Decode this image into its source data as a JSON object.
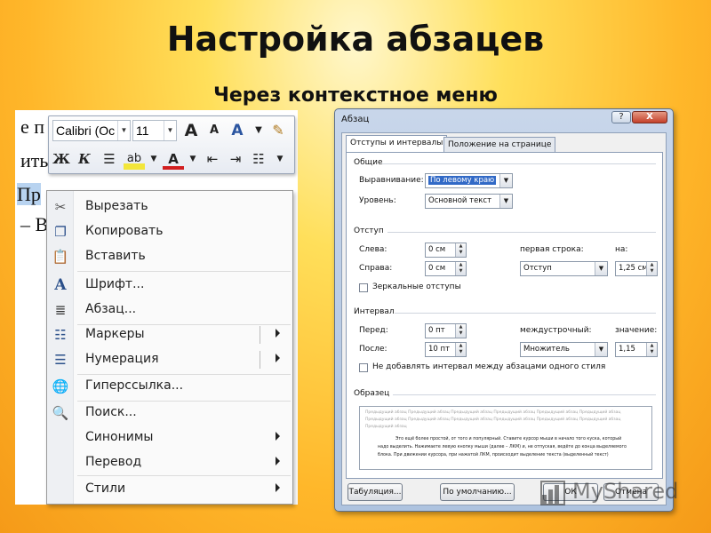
{
  "slide": {
    "title": "Настройка абзацев",
    "subtitle": "Через контекстное меню"
  },
  "document": {
    "lines": [
      "е п",
      "ить",
      "Пр",
      "– В"
    ]
  },
  "mini_toolbar": {
    "font_name": "Calibri (Ос",
    "font_size": "11",
    "grow_font": "A",
    "shrink_font": "A",
    "bold": "Ж",
    "italic": "К"
  },
  "context_menu": {
    "items": [
      {
        "label": "Вырезать",
        "icon": "scissors-icon"
      },
      {
        "label": "Копировать",
        "icon": "copy-icon"
      },
      {
        "label": "Вставить",
        "icon": "paste-icon"
      },
      {
        "label": "Шрифт...",
        "icon": "font-icon"
      },
      {
        "label": "Абзац...",
        "icon": "paragraph-icon"
      },
      {
        "label": "Маркеры",
        "icon": "bullets-icon",
        "submenu": true,
        "split": true
      },
      {
        "label": "Нумерация",
        "icon": "numbering-icon",
        "submenu": true,
        "split": true
      },
      {
        "label": "Гиперссылка...",
        "icon": "hyperlink-icon"
      },
      {
        "label": "Поиск...",
        "icon": "search-icon"
      },
      {
        "label": "Синонимы",
        "icon": "",
        "submenu": true
      },
      {
        "label": "Перевод",
        "icon": "",
        "submenu": true
      },
      {
        "label": "Стили",
        "icon": "",
        "submenu": true
      }
    ]
  },
  "paragraph_dialog": {
    "title": "Абзац",
    "help": "?",
    "close": "X",
    "tabs": [
      "Отступы и интервалы",
      "Положение на странице"
    ],
    "general": {
      "header": "Общие",
      "alignment_label": "Выравнивание:",
      "alignment_value": "По левому краю",
      "level_label": "Уровень:",
      "level_value": "Основной текст"
    },
    "indent": {
      "header": "Отступ",
      "left_label": "Слева:",
      "left_value": "0 см",
      "right_label": "Справа:",
      "right_value": "0 см",
      "first_line_label": "первая строка:",
      "first_line_value": "Отступ",
      "by_label": "на:",
      "by_value": "1,25 см",
      "mirror_label": "Зеркальные отступы"
    },
    "spacing": {
      "header": "Интервал",
      "before_label": "Перед:",
      "before_value": "0 пт",
      "after_label": "После:",
      "after_value": "10 пт",
      "line_label": "междустрочный:",
      "line_value": "Множитель",
      "at_label": "значение:",
      "at_value": "1,15",
      "no_space_label": "Не добавлять интервал между абзацами одного стиля"
    },
    "preview": {
      "header": "Образец",
      "gray_lines": [
        "Предыдущий абзац Предыдущий абзац Предыдущий абзац Предыдущий абзац Предыдущий абзац Предыдущий абзац",
        "Предыдущий абзац Предыдущий абзац Предыдущий абзац Предыдущий абзац Предыдущий абзац Предыдущий абзац",
        "Предыдущий абзац"
      ],
      "dark_lines": [
        "Это ещё более простой, от того и популярный. Ставите курсор мыши в начало того куска, который",
        "надо выделить. Нажимаете левую кнопку мыши (далее – ЛКМ) и, не отпуская, ведёте до конца выделяемого",
        "блока. При движении курсора, при нажатой ЛКМ, происходит выделение текста (выделенный текст)"
      ]
    },
    "buttons": {
      "tabs": "Табуляция...",
      "default": "По умолчанию...",
      "ok": "ОК",
      "cancel": "Отмена"
    }
  },
  "watermark": {
    "text": "MyShared"
  }
}
